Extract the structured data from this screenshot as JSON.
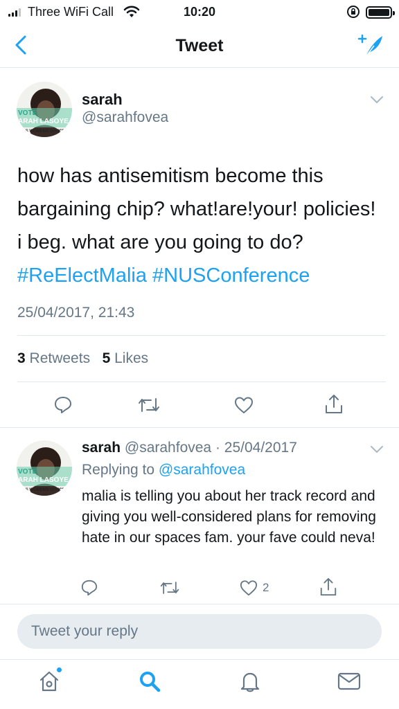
{
  "status_bar": {
    "carrier": "Three WiFi Call",
    "time": "10:20",
    "signal_bars_filled": 3,
    "signal_bars_total": 4
  },
  "nav": {
    "title": "Tweet",
    "back_icon": "chevron-left-icon",
    "compose_icon": "compose-feather-icon"
  },
  "tweet": {
    "author": {
      "name": "sarah",
      "handle": "@sarahfovea"
    },
    "text_plain": "how has antisemitism become this bargaining chip? what!are!your! policies! i beg. what are you going to do?",
    "hashtags": [
      "#ReElectMalia",
      "#NUSConference"
    ],
    "timestamp": "25/04/2017, 21:43",
    "retweets_count": "3",
    "retweets_label": "Retweets",
    "likes_count": "5",
    "likes_label": "Likes"
  },
  "reply": {
    "author_name": "sarah",
    "author_handle": "@sarahfovea",
    "date": "· 25/04/2017",
    "replying_to_label": "Replying to",
    "replying_to_handle": "@sarahfovea",
    "text": "malia is telling you about her track record and giving you well-considered plans for removing hate in our spaces fam. your fave could neva!",
    "like_count": "2"
  },
  "reply_bar": {
    "placeholder": "Tweet your reply"
  },
  "tab_bar": {
    "items": [
      "home-icon",
      "search-icon",
      "notifications-bell-icon",
      "messages-envelope-icon"
    ]
  },
  "colors": {
    "accent": "#1da1f2",
    "text_primary": "#14171a",
    "text_secondary": "#657786",
    "divider": "#e1e8ed"
  }
}
